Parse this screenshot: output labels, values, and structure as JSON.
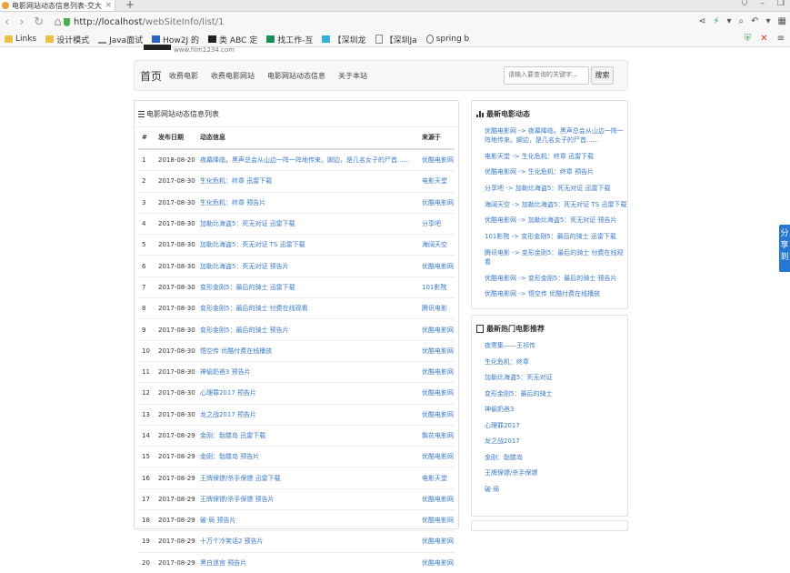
{
  "browser": {
    "tab_title": "电影网站动态信息列表-交大传习阁",
    "new_tab": "+",
    "url_host": "http://localhost",
    "url_path": "/webSiteInfo/list/1",
    "bookmarks": [
      "Links",
      "设计模式",
      "Java面试",
      "How2J 的",
      "类 ABC 定",
      "找工作-互",
      "【深圳龙",
      "【深圳Ja",
      "spring b"
    ]
  },
  "site": {
    "logo_text": "www.film1234.com",
    "nav": {
      "brand": "首页",
      "links": [
        "收费电影",
        "收费电影网站",
        "电影网站动态信息",
        "关于本站"
      ]
    },
    "search": {
      "placeholder": "请输入要查询的关键字...",
      "button": "搜索"
    }
  },
  "main": {
    "title": "电影网站动态信息列表",
    "columns": [
      "#",
      "发布日期",
      "动态信息",
      "来源于"
    ],
    "rows": [
      {
        "n": "1",
        "date": "2018-08-20",
        "info": "夜幕降临，黑声总会从山边一阵一阵地传来。脚边，是几名女子的尸首......",
        "src": "优酷电影网"
      },
      {
        "n": "2",
        "date": "2017-08-30",
        "info": "生化危机：终章 迅雷下载",
        "src": "电影天堂"
      },
      {
        "n": "3",
        "date": "2017-08-30",
        "info": "生化危机：终章 预告片",
        "src": "优酷电影网"
      },
      {
        "n": "4",
        "date": "2017-08-30",
        "info": "加勒比海盗5：死无对证 迅雷下载",
        "src": "分享吧"
      },
      {
        "n": "5",
        "date": "2017-08-30",
        "info": "加勒比海盗5：死无对证 TS 迅雷下载",
        "src": "海阔天空"
      },
      {
        "n": "6",
        "date": "2017-08-30",
        "info": "加勒比海盗5：死无对证 预告片",
        "src": "优酷电影网"
      },
      {
        "n": "7",
        "date": "2017-08-30",
        "info": "变形金刚5：最后的骑士 迅雷下载",
        "src": "101影院"
      },
      {
        "n": "8",
        "date": "2017-08-30",
        "info": "变形金刚5：最后的骑士 付费在线观看",
        "src": "腾讯电影"
      },
      {
        "n": "9",
        "date": "2017-08-30",
        "info": "变形金刚5：最后的骑士 预告片",
        "src": "优酷电影网"
      },
      {
        "n": "10",
        "date": "2017-08-30",
        "info": "悟空传 优酷付费在线播放",
        "src": "优酷电影网"
      },
      {
        "n": "11",
        "date": "2017-08-30",
        "info": "神偷奶爸3 预告片",
        "src": "优酷电影网"
      },
      {
        "n": "12",
        "date": "2017-08-30",
        "info": "心理罪2017 预告片",
        "src": "优酷电影网"
      },
      {
        "n": "13",
        "date": "2017-08-30",
        "info": "龙之战2017 预告片",
        "src": "优酷电影网"
      },
      {
        "n": "14",
        "date": "2017-08-29",
        "info": "金刚：骷髅岛 迅雷下载",
        "src": "飘花电影网"
      },
      {
        "n": "15",
        "date": "2017-08-29",
        "info": "金刚：骷髅岛 预告片",
        "src": "优酷电影网"
      },
      {
        "n": "16",
        "date": "2017-08-29",
        "info": "王牌保镖/杀手保镖 迅雷下载",
        "src": "电影天堂"
      },
      {
        "n": "17",
        "date": "2017-08-29",
        "info": "王牌保镖/杀手保镖 预告片",
        "src": "优酷电影网"
      },
      {
        "n": "18",
        "date": "2017-08-29",
        "info": "破·局 预告片",
        "src": "优酷电影网"
      },
      {
        "n": "19",
        "date": "2017-08-29",
        "info": "十万个冷笑话2 预告片",
        "src": "优酷电影网"
      },
      {
        "n": "20",
        "date": "2017-08-29",
        "info": "黑白迷宫 预告片",
        "src": "优酷电影网"
      }
    ]
  },
  "sidebar": {
    "latest_title": "最新电影动态",
    "latest": [
      "优酷电影网 -> 夜幕降临，黑声总会从山边一阵一阵地传来。脚边，是几名女子的尸首......",
      "电影天堂 -> 生化危机：终章 迅雷下载",
      "优酷电影网 -> 生化危机：终章 预告片",
      "分享吧 -> 加勒比海盗5：死无对证 迅雷下载",
      "海阔天空 -> 加勒比海盗5：死无对证 TS 迅雷下载",
      "优酷电影网 -> 加勒比海盗5：死无对证 预告片",
      "101影院 -> 变形金刚5：最后的骑士 迅雷下载",
      "腾讯电影 -> 变形金刚5：最后的骑士 付费在线观看",
      "优酷电影网 -> 变形金刚5：最后的骑士 预告片",
      "优酷电影网 -> 悟空传 优酷付费在线播放"
    ],
    "hot_title": "最新热门电影推荐",
    "hot": [
      "夜寒集——王祁传",
      "生化危机：终章",
      "加勒比海盗5：死无对证",
      "变形金刚5：最后的骑士",
      "神偷奶爸3",
      "心理罪2017",
      "龙之战2017",
      "金刚：骷髅岛",
      "王牌保镖/杀手保镖",
      "破·局"
    ]
  },
  "share": {
    "label": "分享到"
  },
  "colors": {
    "link": "#3a79c7",
    "share_bg": "#2778d3"
  }
}
